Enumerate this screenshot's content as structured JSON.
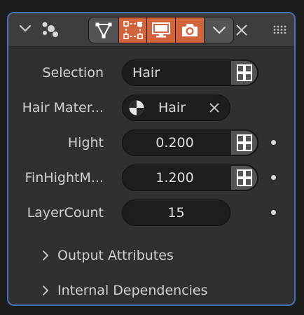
{
  "header": {
    "collapse_icon": "chevron-down-icon",
    "node_icon": "hair-node-icon",
    "toggles": [
      {
        "name": "edit-mode-toggle",
        "icon": "vertex-triangle-icon",
        "active": false
      },
      {
        "name": "selection-toggle",
        "icon": "bounding-box-icon",
        "active": true
      },
      {
        "name": "viewport-toggle",
        "icon": "monitor-icon",
        "active": true
      },
      {
        "name": "render-toggle",
        "icon": "camera-icon",
        "active": true
      }
    ],
    "dropdown_icon": "chevron-down-icon",
    "close_icon": "close-icon",
    "grip_icon": "drag-grip-icon"
  },
  "inputs": {
    "selection": {
      "label": "Selection",
      "value": "Hair"
    },
    "hair_material": {
      "label": "Hair Mater...",
      "value": "Hair"
    },
    "hight": {
      "label": "Hight",
      "value": "0.200"
    },
    "fin_hight": {
      "label": "FinHightM...",
      "value": "1.200"
    },
    "layer_count": {
      "label": "LayerCount",
      "value": "15"
    }
  },
  "sections": [
    {
      "label": "Output Attributes",
      "expanded": false
    },
    {
      "label": "Internal Dependencies",
      "expanded": false
    }
  ],
  "colors": {
    "accent_border": "#4772b3",
    "toggle_active": "#d1643c",
    "panel_bg": "#303030",
    "field_bg": "#1e1e1e"
  }
}
